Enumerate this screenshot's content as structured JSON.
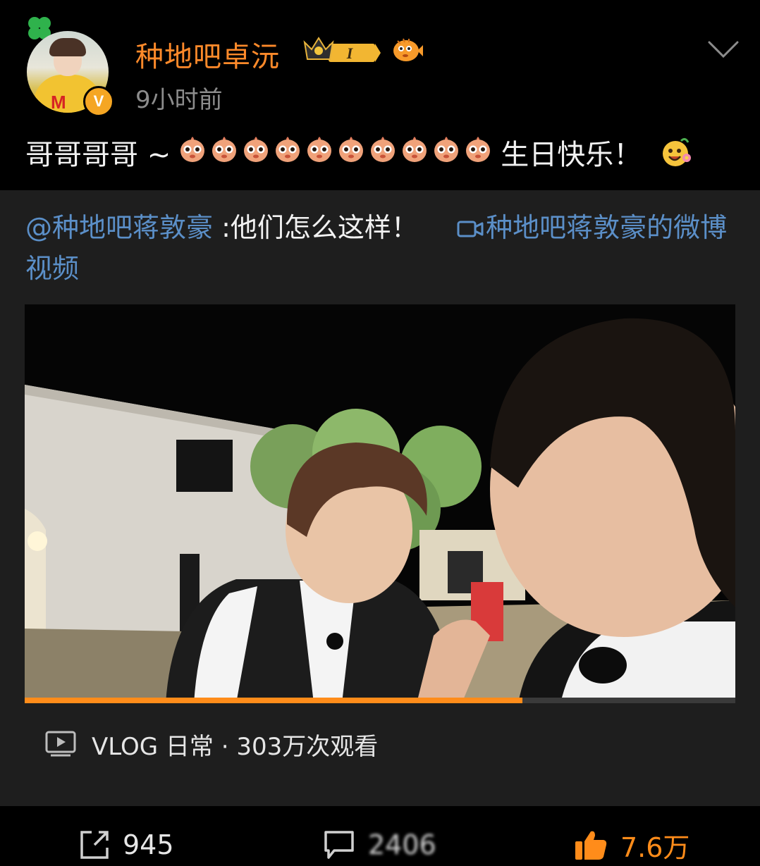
{
  "post": {
    "author": "种地吧卓沅",
    "time": "9小时前",
    "text_before": "哥哥哥哥 ~",
    "text_after": "生日快乐！",
    "avatar_badge": "V",
    "avatar_shirt_letter": "M",
    "level_badge": "I"
  },
  "icons": {
    "chick_emoji": "chick-emoji-icon",
    "smile_emoji": "smile-flower-emoji-icon",
    "crown_badge": "crown-level-badge-icon",
    "fish_badge": "puffer-fish-badge-icon",
    "chevron": "chevron-down-icon",
    "camera": "video-camera-icon",
    "play_box": "play-box-icon",
    "share": "share-icon",
    "comment": "comment-icon",
    "like": "thumbs-up-icon"
  },
  "repost": {
    "mention": "@种地吧蒋敦豪",
    "text": " :他们怎么这样！",
    "video_link": "种地吧蒋敦豪的微博视频",
    "video_progress": 0.7,
    "video_meta": "VLOG 日常 · 303万次观看"
  },
  "actions": {
    "reposts": "945",
    "comments": "2406",
    "likes": "7.6万"
  },
  "colors": {
    "username": "#ff8a2a",
    "link": "#5b8fc8",
    "accent": "#ff8c1a",
    "card_bg": "#1e1e1e",
    "page_bg": "#000000"
  }
}
